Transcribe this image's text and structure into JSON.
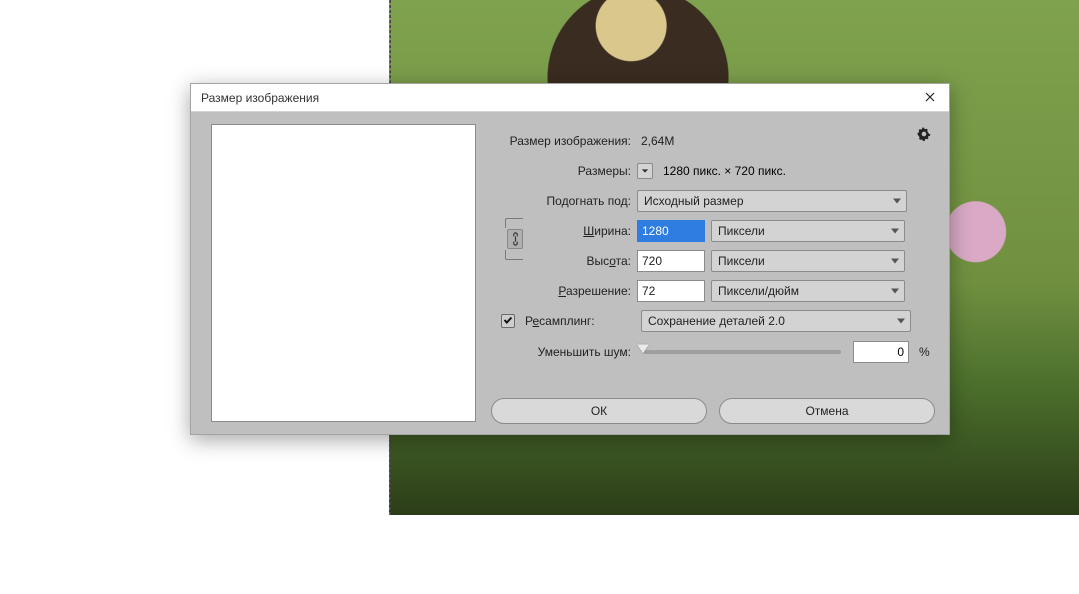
{
  "dialog": {
    "title": "Размер изображения",
    "size_label": "Размер изображения:",
    "size_value": "2,64M",
    "dims_label": "Размеры:",
    "dims_value": "1280 пикс. × 720 пикс.",
    "fit_label": "Подогнать под:",
    "fit_value": "Исходный размер",
    "width_label": "Ширина:",
    "width_value": "1280",
    "width_unit": "Пиксели",
    "height_label": "Высота:",
    "height_value": "720",
    "height_unit": "Пиксели",
    "resolution_label": "Разрешение:",
    "resolution_value": "72",
    "resolution_unit": "Пиксели/дюйм",
    "resample_label": "Ресамплинг:",
    "resample_value": "Сохранение деталей 2.0",
    "resample_checked": true,
    "noise_label": "Уменьшить шум:",
    "noise_value": "0",
    "noise_unit": "%",
    "ok": "ОК",
    "cancel": "Отмена"
  }
}
